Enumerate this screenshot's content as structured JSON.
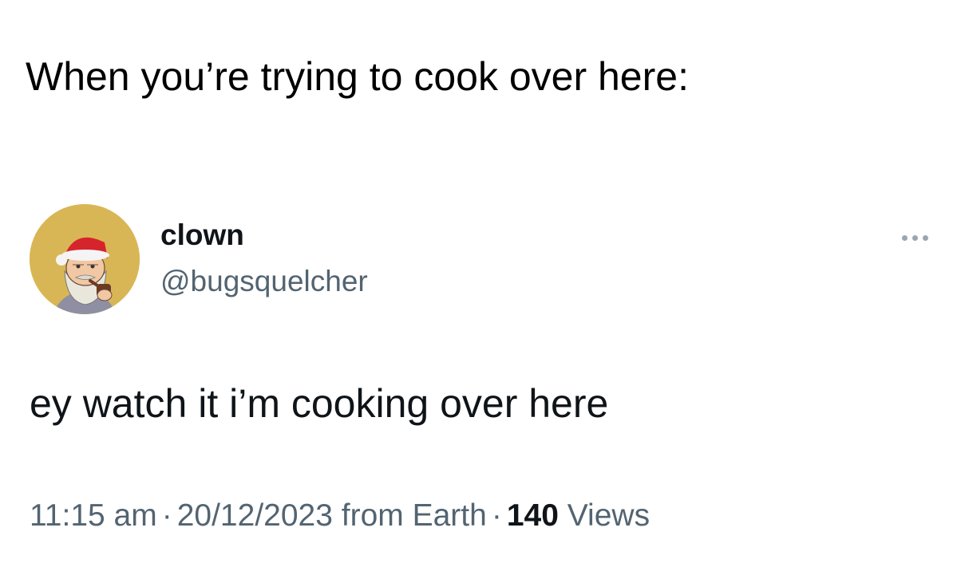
{
  "caption": "When you’re trying to cook over here:",
  "tweet": {
    "display_name": "clown",
    "handle": "@bugsquelcher",
    "text": "ey watch it i’m cooking over here",
    "time": "11:15 am",
    "date": "20/12/2023",
    "source": "from Earth",
    "separator": "·",
    "views_count": "140",
    "views_label": "Views",
    "avatar_icon": "cartoon-santa-pipe-avatar",
    "more_icon": "ellipsis-icon"
  },
  "colors": {
    "name_text": "#0f1419",
    "secondary_text": "#536471",
    "avatar_bg": "#d9b655"
  }
}
